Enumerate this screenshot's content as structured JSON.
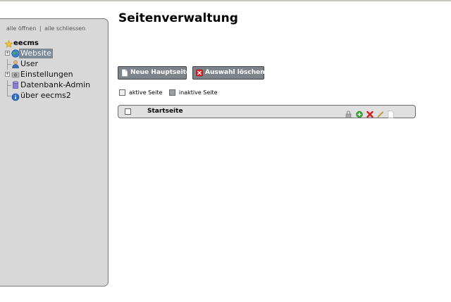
{
  "sidebar": {
    "links": {
      "open_all": "alle öffnen",
      "separator": "|",
      "close_all": "alle schliessen"
    },
    "tree": {
      "root": {
        "label": "eecms",
        "icon": "star-icon"
      },
      "items": [
        {
          "label": "Website",
          "icon": "globe-icon",
          "expandable": true,
          "selected": true
        },
        {
          "label": "User",
          "icon": "user-icon",
          "expandable": false
        },
        {
          "label": "Einstellungen",
          "icon": "settings-icon",
          "expandable": true
        },
        {
          "label": "Datenbank-Admin",
          "icon": "database-icon",
          "expandable": false
        },
        {
          "label": "über eecms2",
          "icon": "info-icon",
          "expandable": false
        }
      ]
    }
  },
  "main": {
    "title": "Seitenverwaltung",
    "buttons": {
      "new_page": "Neue Hauptseite",
      "delete_selection": "Auswahl löschen"
    },
    "legend": {
      "active": "aktive Seite",
      "inactive": "inaktive Seite"
    },
    "pages": [
      {
        "title": "Startseite",
        "actions": [
          "lock-icon",
          "add-icon",
          "delete-icon",
          "edit-icon",
          "page-icon"
        ]
      }
    ]
  },
  "colors": {
    "sidebar_bg": "#d8d8d8",
    "button_bg": "#7d838a",
    "row_bg": "#e0e0e0",
    "selected_bg": "#7c8a96"
  }
}
